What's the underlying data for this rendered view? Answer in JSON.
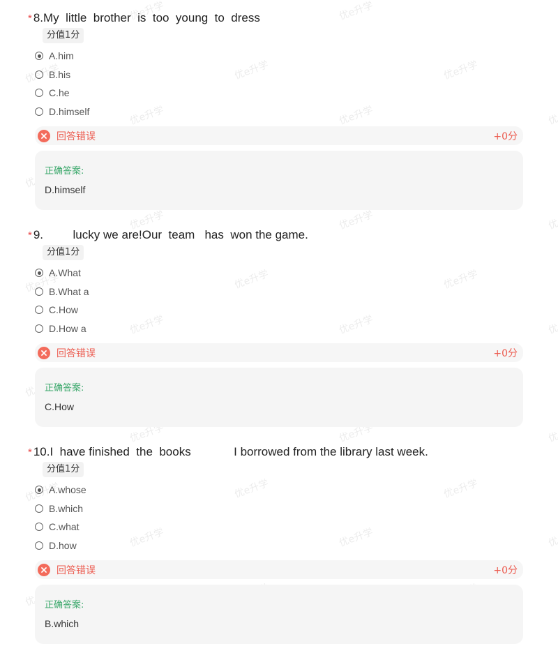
{
  "watermark_text": "优e升学",
  "questions": [
    {
      "star": "*",
      "title": "8.My  little  brother  is  too  young  to  dress",
      "score": "分值1分",
      "options": [
        "A.him",
        "B.his",
        "C.he",
        "D.himself"
      ],
      "selected_index": 0,
      "result_text": "回答错误",
      "result_score": "+0分",
      "answer_label": "正确答案:",
      "answer_value": "D.himself"
    },
    {
      "star": "*",
      "title": "9.         lucky we are!Our  team   has  won the game.",
      "score": "分值1分",
      "options": [
        "A.What",
        "B.What a",
        "C.How",
        "D.How a"
      ],
      "selected_index": 0,
      "result_text": "回答错误",
      "result_score": "+0分",
      "answer_label": "正确答案:",
      "answer_value": "C.How"
    },
    {
      "star": "*",
      "title": "10.I  have finished  the  books             I borrowed from the library last week.",
      "score": "分值1分",
      "options": [
        "A.whose",
        "B.which",
        "C.what",
        "D.how"
      ],
      "selected_index": 0,
      "result_text": "回答错误",
      "result_score": "+0分",
      "answer_label": "正确答案:",
      "answer_value": "B.which"
    }
  ],
  "colors": {
    "required_star": "#e84a4a",
    "wrong": "#ec5b4f",
    "wrong_icon": "#f36b5b",
    "correct_label": "#3ba86b"
  },
  "icons": {
    "wrong": "close-circle-icon"
  }
}
